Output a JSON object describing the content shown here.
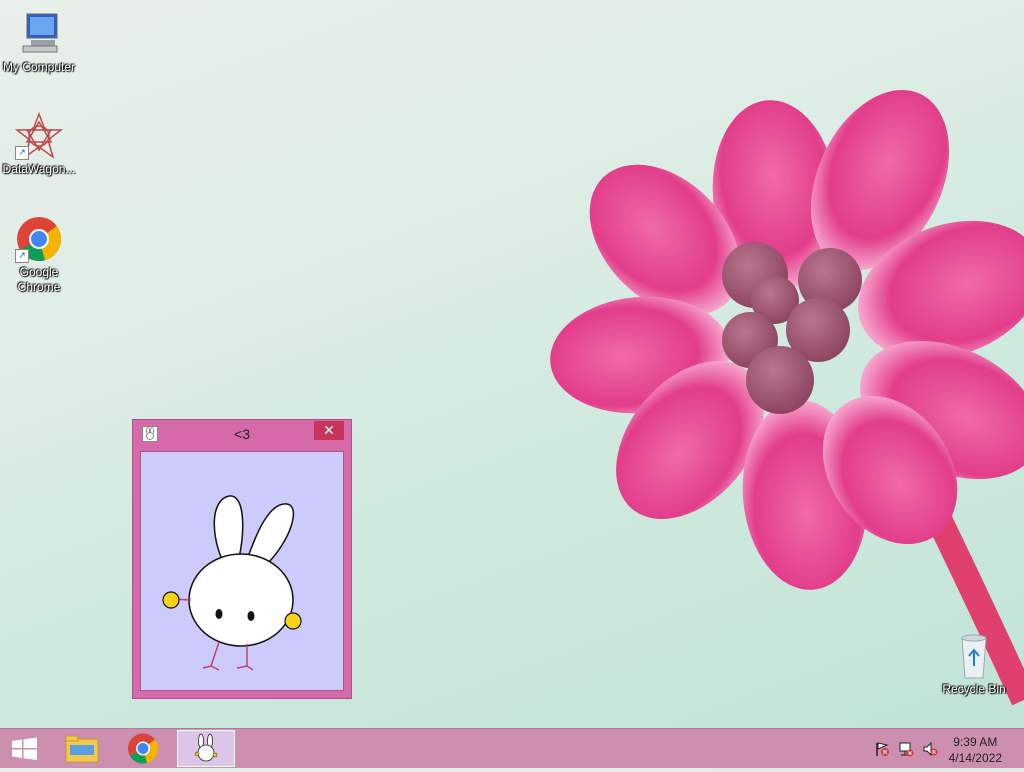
{
  "desktop": {
    "icons": [
      {
        "label": "My Computer",
        "icon": "computer-icon"
      },
      {
        "label": "DataWagon...",
        "icon": "datawagon-icon"
      },
      {
        "label_line1": "Google",
        "label_line2": "Chrome",
        "icon": "chrome-icon"
      },
      {
        "label": "Recycle Bin",
        "icon": "recycle-bin-icon"
      }
    ]
  },
  "window": {
    "title": "<3",
    "close_glyph": "✕",
    "colors": {
      "frame": "#d66aa8",
      "client": "#cccbfc",
      "close": "#c7365a"
    }
  },
  "taskbar": {
    "items": [
      {
        "icon": "windows-start-icon"
      },
      {
        "icon": "file-explorer-icon"
      },
      {
        "icon": "chrome-icon"
      },
      {
        "icon": "bunny-app-icon",
        "active": true
      }
    ],
    "tray": [
      {
        "icon": "action-center-flag-icon"
      },
      {
        "icon": "network-icon"
      },
      {
        "icon": "volume-muted-icon"
      }
    ],
    "time": "9:39 AM",
    "date": "4/14/2022"
  }
}
